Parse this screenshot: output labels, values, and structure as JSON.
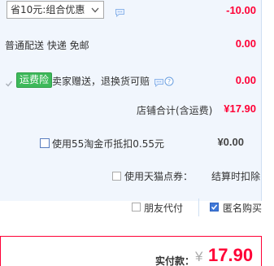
{
  "promo": {
    "select_value": "省10元:组合优惠",
    "amount": "-10.00"
  },
  "shipping": {
    "label": "普通配送 快递 免邮",
    "amount": "0.00"
  },
  "insurance": {
    "badge": "运费险",
    "text": "卖家赠送，退换货可赔",
    "amount": "0.00"
  },
  "store_total": {
    "label": "店铺合计(含运费)",
    "amount": "¥17.90"
  },
  "coins": {
    "label": "使用55淘金币抵扣0.55元",
    "amount": "¥0.00"
  },
  "tmall_points": {
    "label": "使用天猫点券：",
    "note": "结算时扣除"
  },
  "options": {
    "friend_pay": "朋友代付",
    "anonymous": "匿名购买"
  },
  "footer": {
    "label": "实付款：",
    "currency": "¥",
    "amount": "17.90"
  },
  "colors": {
    "accent_red": "#ff0036",
    "badge_green": "#3eb95a",
    "panel_bg": "#f1f6fd",
    "checkbox_blue": "#3f78d8"
  },
  "icons": [
    "chevron-down-icon",
    "chat-bubble-icon",
    "question-icon",
    "checkmark-icon"
  ]
}
